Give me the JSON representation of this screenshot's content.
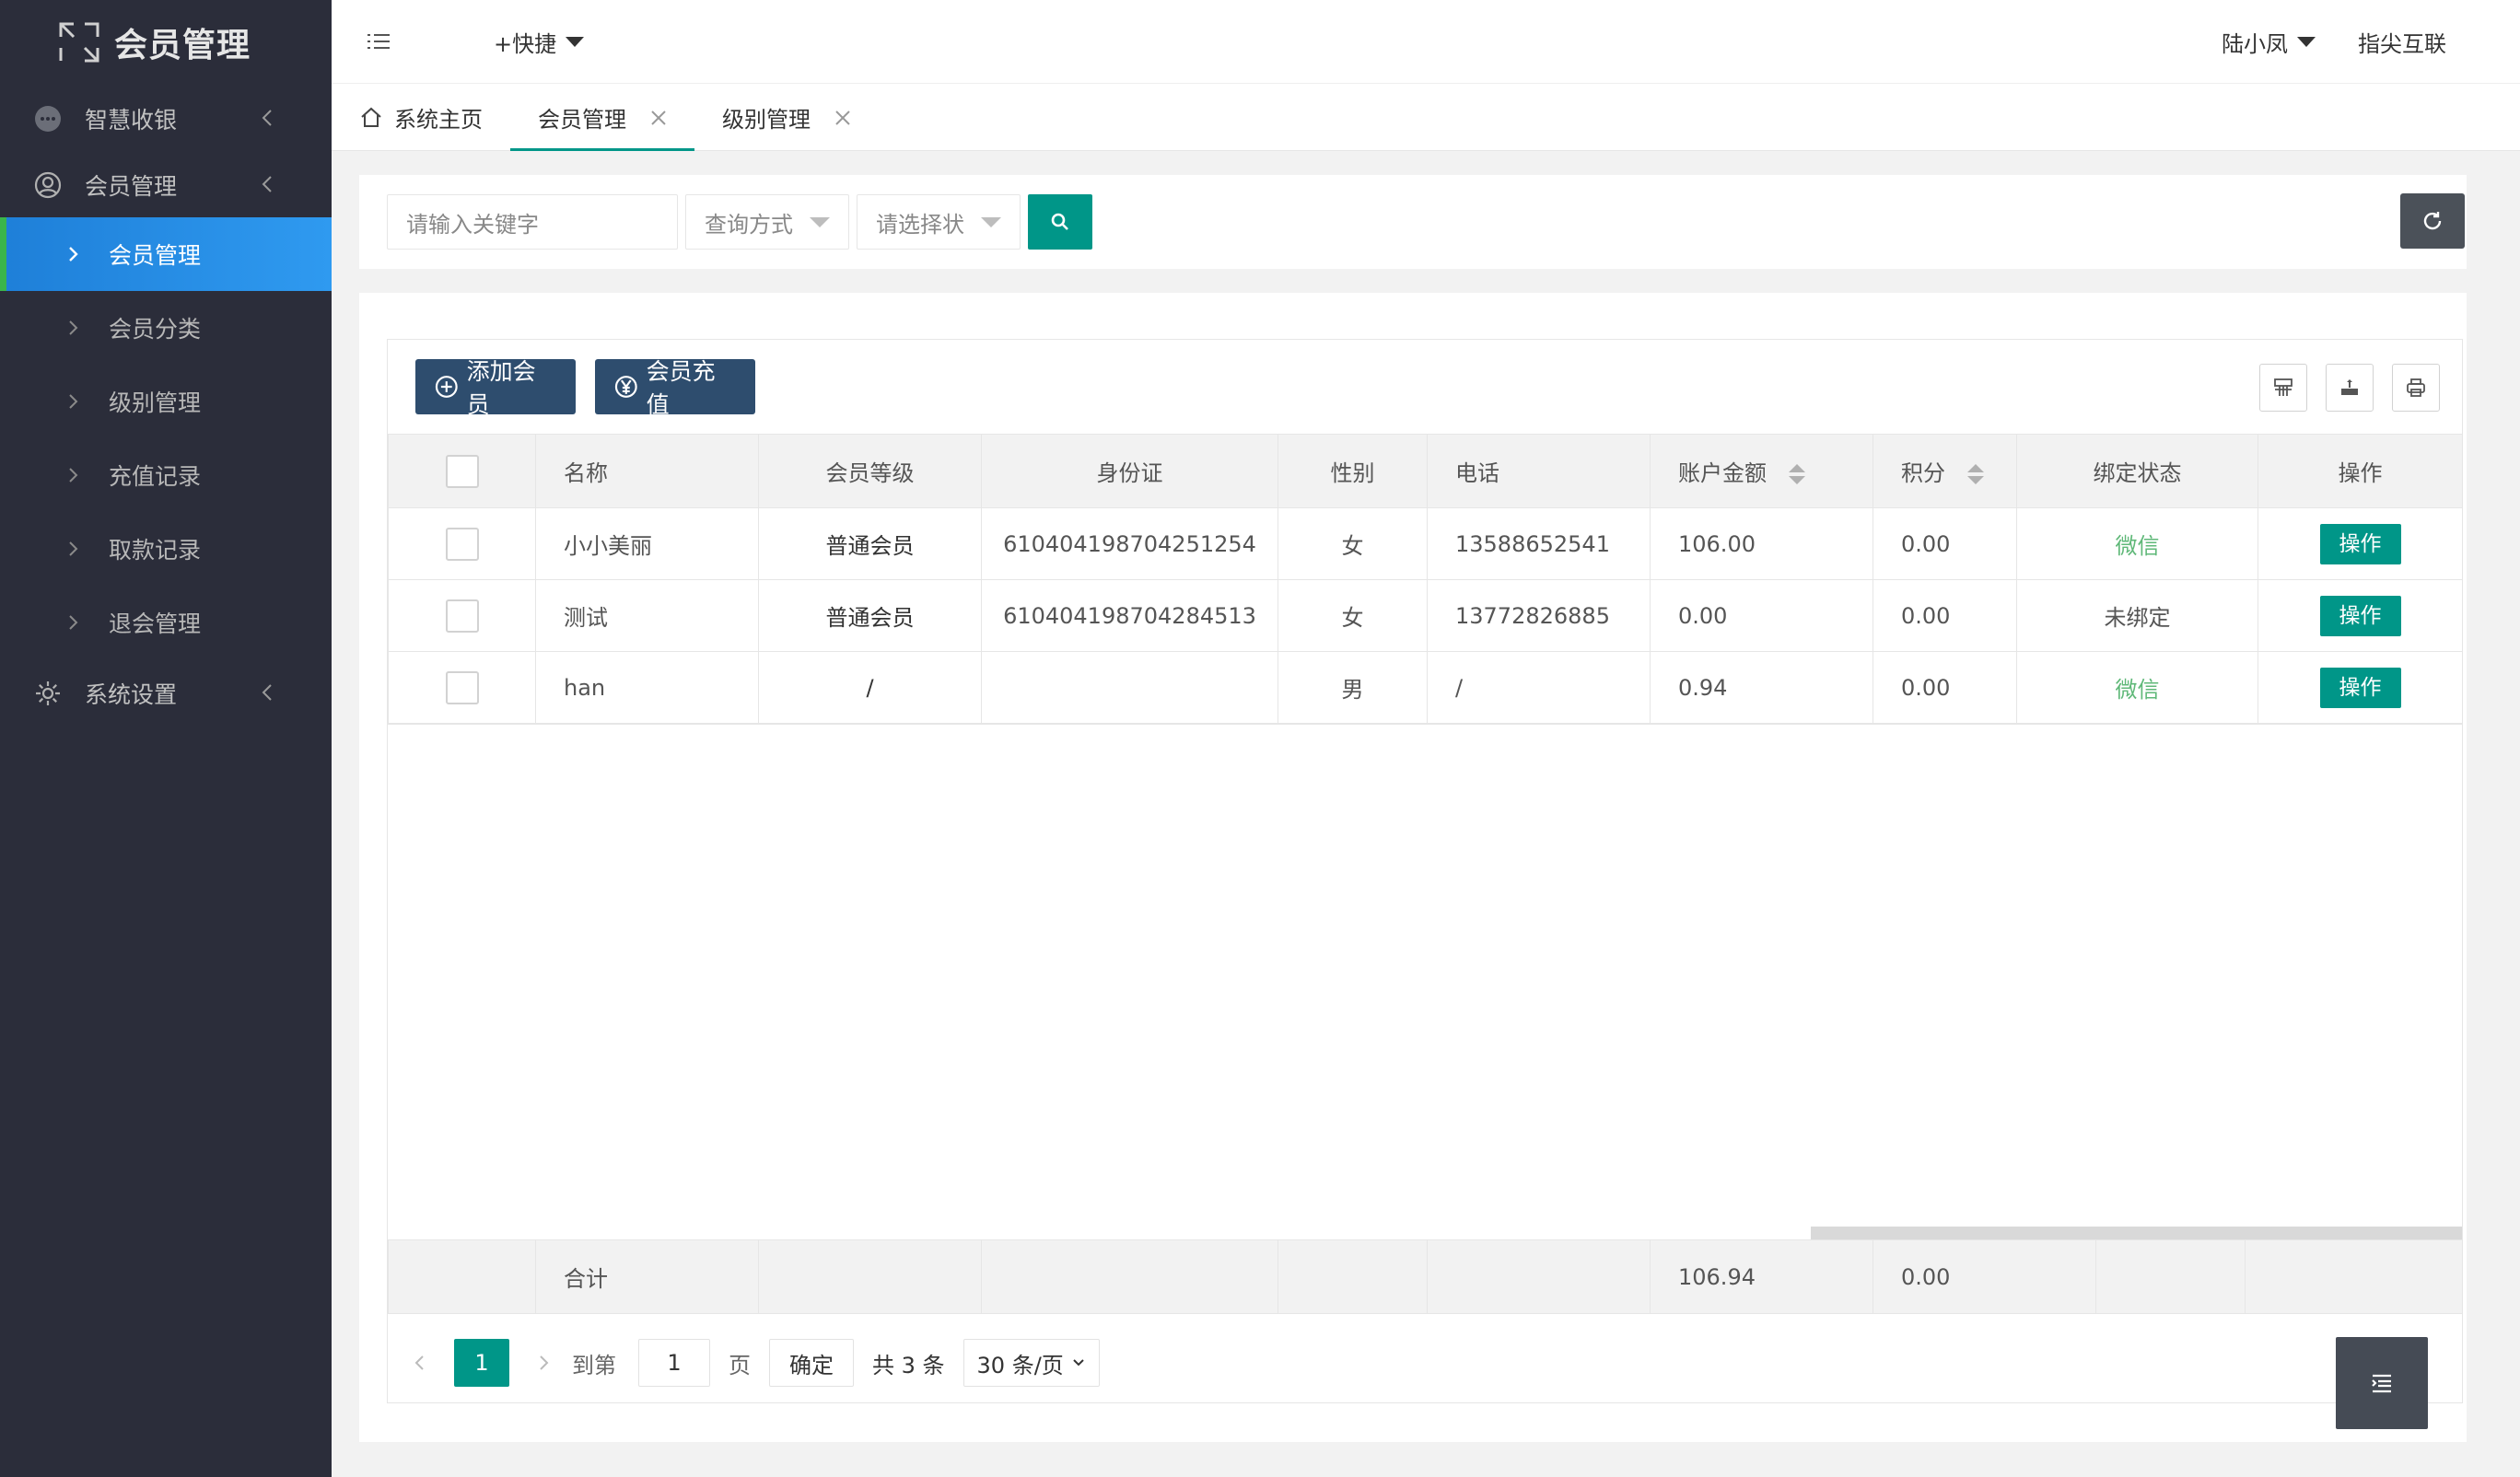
{
  "app": {
    "title": "会员管理"
  },
  "sidebar": {
    "groups": [
      {
        "label": "智慧收银",
        "icon": "chat-bubble-icon"
      },
      {
        "label": "会员管理",
        "icon": "user-circle-icon"
      },
      {
        "label": "系统设置",
        "icon": "gear-icon"
      }
    ],
    "items": [
      {
        "label": "会员管理",
        "active": true
      },
      {
        "label": "会员分类"
      },
      {
        "label": "级别管理"
      },
      {
        "label": "充值记录"
      },
      {
        "label": "取款记录"
      },
      {
        "label": "退会管理"
      }
    ]
  },
  "header": {
    "quick_label": "+快捷",
    "user_name": "陆小凤",
    "company": "指尖互联"
  },
  "tabs": [
    {
      "label": "系统主页"
    },
    {
      "label": "会员管理"
    },
    {
      "label": "级别管理"
    }
  ],
  "search": {
    "keyword_placeholder": "请输入关键字",
    "query_mode_placeholder": "查询方式",
    "status_placeholder": "请选择状"
  },
  "toolbar": {
    "add_label": "添加会员",
    "recharge_label": "会员充值"
  },
  "table": {
    "headers": [
      "名称",
      "会员等级",
      "身份证",
      "性别",
      "电话",
      "账户金额",
      "积分",
      "绑定状态",
      "操作"
    ],
    "rows": [
      {
        "name": "小小美丽",
        "level": "普通会员",
        "id_card": "610404198704251254",
        "gender": "女",
        "phone": "13588652541",
        "balance": "106.00",
        "points": "0.00",
        "bind": "微信",
        "op": "操作"
      },
      {
        "name": "测试",
        "level": "普通会员",
        "id_card": "610404198704284513",
        "gender": "女",
        "phone": "13772826885",
        "balance": "0.00",
        "points": "0.00",
        "bind": "未绑定",
        "op": "操作"
      },
      {
        "name": "han",
        "level": "/",
        "id_card": "",
        "gender": "男",
        "phone": "/",
        "balance": "0.94",
        "points": "0.00",
        "bind": "微信",
        "op": "操作"
      }
    ],
    "summary": {
      "label": "合计",
      "balance": "106.94",
      "points": "0.00"
    }
  },
  "pager": {
    "current": "1",
    "goto_label": "到第",
    "goto_value": "1",
    "page_label": "页",
    "confirm_label": "确定",
    "total_label": "共 3 条",
    "page_size": "30 条/页"
  },
  "colors": {
    "accent": "#009688",
    "sidebar_bg": "#2b2d3a",
    "active_blue": "#1e88e5",
    "btn_dark": "#2e4d6e",
    "bind_green": "#5fb878"
  }
}
